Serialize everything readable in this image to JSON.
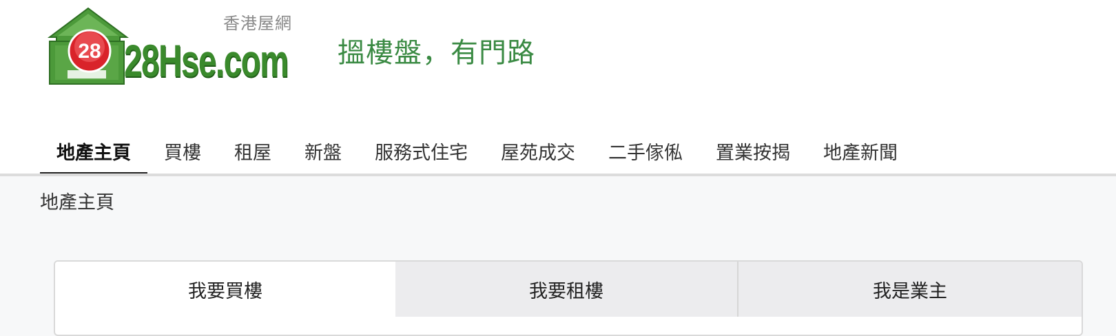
{
  "logo": {
    "badge_number": "28",
    "site_name": "28Hse.com",
    "tagline": "香港屋網",
    "colors": {
      "green": "#3a8a2c",
      "red": "#d9232a"
    }
  },
  "slogan": "搵樓盤，有門路",
  "nav": {
    "active_index": 0,
    "items": [
      {
        "label": "地產主頁"
      },
      {
        "label": "買樓"
      },
      {
        "label": "租屋"
      },
      {
        "label": "新盤"
      },
      {
        "label": "服務式住宅"
      },
      {
        "label": "屋苑成交"
      },
      {
        "label": "二手傢俬"
      },
      {
        "label": "置業按揭"
      },
      {
        "label": "地產新聞"
      }
    ]
  },
  "breadcrumb": "地產主頁",
  "tabs": {
    "active_index": 0,
    "items": [
      {
        "label": "我要買樓"
      },
      {
        "label": "我要租樓"
      },
      {
        "label": "我是業主"
      }
    ]
  }
}
